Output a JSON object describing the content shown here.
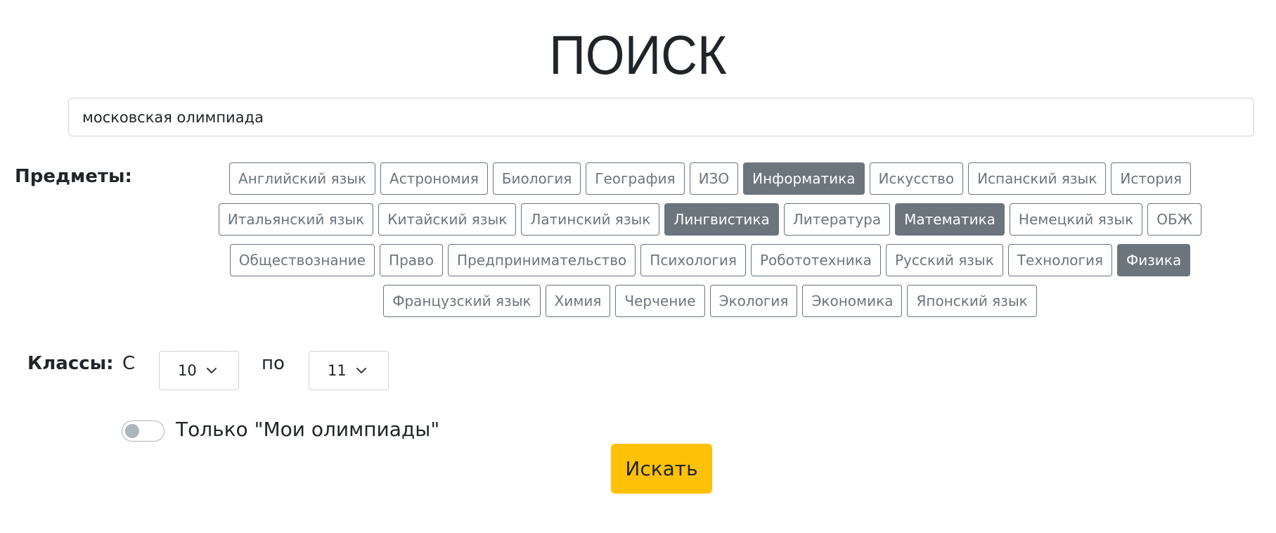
{
  "page": {
    "title": "ПОИСК"
  },
  "search": {
    "value": "московская олимпиада"
  },
  "subjects": {
    "label": "Предметы:",
    "rows": [
      [
        {
          "label": "Английский язык",
          "selected": false
        },
        {
          "label": "Астрономия",
          "selected": false
        },
        {
          "label": "Биология",
          "selected": false
        },
        {
          "label": "География",
          "selected": false
        },
        {
          "label": "ИЗО",
          "selected": false
        },
        {
          "label": "Информатика",
          "selected": true
        },
        {
          "label": "Искусство",
          "selected": false
        },
        {
          "label": "Испанский язык",
          "selected": false
        },
        {
          "label": "История",
          "selected": false
        }
      ],
      [
        {
          "label": "Итальянский язык",
          "selected": false
        },
        {
          "label": "Китайский язык",
          "selected": false
        },
        {
          "label": "Латинский язык",
          "selected": false
        },
        {
          "label": "Лингвистика",
          "selected": true
        },
        {
          "label": "Литература",
          "selected": false
        },
        {
          "label": "Математика",
          "selected": true
        },
        {
          "label": "Немецкий язык",
          "selected": false
        },
        {
          "label": "ОБЖ",
          "selected": false
        }
      ],
      [
        {
          "label": "Обществознание",
          "selected": false
        },
        {
          "label": "Право",
          "selected": false
        },
        {
          "label": "Предпринимательство",
          "selected": false
        },
        {
          "label": "Психология",
          "selected": false
        },
        {
          "label": "Робототехника",
          "selected": false
        },
        {
          "label": "Русский язык",
          "selected": false
        },
        {
          "label": "Технология",
          "selected": false
        },
        {
          "label": "Физика",
          "selected": true
        }
      ],
      [
        {
          "label": "Французский язык",
          "selected": false
        },
        {
          "label": "Химия",
          "selected": false
        },
        {
          "label": "Черчение",
          "selected": false
        },
        {
          "label": "Экология",
          "selected": false
        },
        {
          "label": "Экономика",
          "selected": false
        },
        {
          "label": "Японский язык",
          "selected": false
        }
      ]
    ]
  },
  "grades": {
    "label": "Классы:",
    "from_label": "С",
    "from_value": "10",
    "to_label": "по",
    "to_value": "11"
  },
  "my_olympiads": {
    "label": "Только \"Мои олимпиады\"",
    "checked": false
  },
  "search_button": {
    "label": "Искать"
  },
  "colors": {
    "chip_border": "#6c757d",
    "chip_selected_bg": "#6c757d",
    "search_button_bg": "#ffc107"
  },
  "icons": {
    "select_indicator": "chevron-down-icon"
  }
}
